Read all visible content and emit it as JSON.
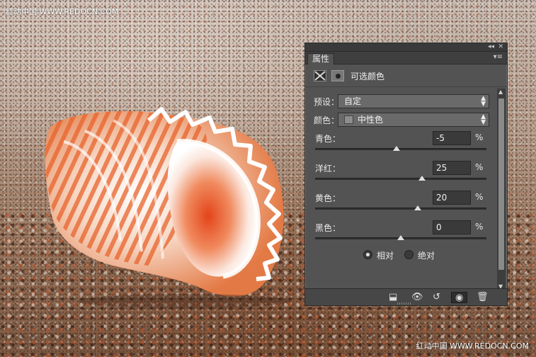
{
  "watermark": {
    "top": "红动中国 WWW.REDOCN.COM",
    "bottom": "红动中国 WWW.REDOCN.COM"
  },
  "panel": {
    "tab_label": "属性",
    "title": "可选颜色",
    "collapse_glyph": "◂◂",
    "close_glyph": "✕",
    "menu_glyph": "▾≡",
    "icons": {
      "adjustment": "selective-color-icon",
      "mask": "layer-mask-icon"
    },
    "preset": {
      "label": "预设：",
      "value": "自定"
    },
    "colors": {
      "label": "颜色：",
      "value": "中性色",
      "swatch_color": "#8d8d8d"
    },
    "sliders": [
      {
        "label": "青色：",
        "value": "-5",
        "unit": "%",
        "level": -5
      },
      {
        "label": "洋红：",
        "value": "25",
        "unit": "%",
        "level": 25
      },
      {
        "label": "黄色：",
        "value": "20",
        "unit": "%",
        "level": 20
      },
      {
        "label": "黑色：",
        "value": "0",
        "unit": "%",
        "level": 0
      }
    ],
    "method": {
      "relative": "相对",
      "absolute": "绝对",
      "selected": "relative"
    },
    "footer_icons": [
      "clip-to-layer-icon",
      "view-previous-icon",
      "reset-icon",
      "visibility-icon",
      "trash-icon"
    ]
  },
  "colors": {
    "panel_bg": "#535353",
    "title_bg": "#3a3a3a",
    "input_bg": "#3a3a3a",
    "text": "#e8e8e8"
  }
}
